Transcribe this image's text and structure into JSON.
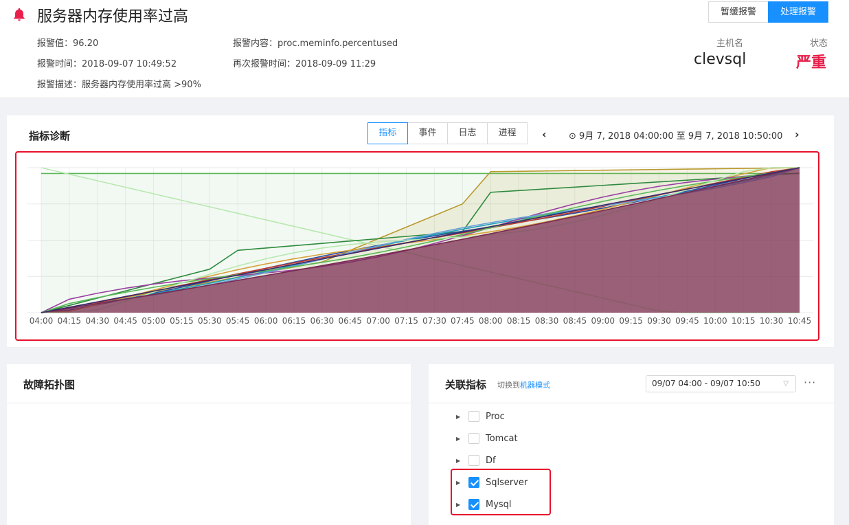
{
  "alert": {
    "title": "服务器内存使用率过高",
    "value_label": "报警值：",
    "value": "96.20",
    "time_label": "报警时间：",
    "time": "2018-09-07 10:49:52",
    "desc_label": "报警描述：",
    "desc": "服务器内存使用率过高 >90%",
    "content_label": "报警内容：",
    "content": "proc.meminfo.percentused",
    "retime_label": "再次报警时间：",
    "retime": "2018-09-09 11:29",
    "host_label": "主机名",
    "host": "clevsql",
    "status_label": "状态",
    "status": "严重",
    "snooze_button": "暂缓报警",
    "handle_button": "处理报警"
  },
  "diagnosis": {
    "title": "指标诊断",
    "tabs": [
      "指标",
      "事件",
      "日志",
      "进程"
    ],
    "active_tab": 0,
    "time_range": "9月 7, 2018 04:00:00 至 9月 7, 2018 10:50:00"
  },
  "topology": {
    "title": "故障拓扑图"
  },
  "related": {
    "title": "关联指标",
    "switch_prefix": "切换到",
    "switch_link": "机器模式",
    "date_range": "09/07 04:00 - 09/07 10:50",
    "items": [
      {
        "label": "Proc",
        "checked": false
      },
      {
        "label": "Tomcat",
        "checked": false
      },
      {
        "label": "Df",
        "checked": false
      },
      {
        "label": "Sqlserver",
        "checked": true
      },
      {
        "label": "Mysql",
        "checked": true
      }
    ]
  },
  "chart_data": {
    "type": "area",
    "x": [
      "04:00",
      "04:15",
      "04:30",
      "04:45",
      "05:00",
      "05:15",
      "05:30",
      "05:45",
      "06:00",
      "06:15",
      "06:30",
      "06:45",
      "07:00",
      "07:15",
      "07:30",
      "07:45",
      "08:00",
      "08:15",
      "08:30",
      "08:45",
      "09:00",
      "09:15",
      "09:30",
      "09:45",
      "10:00",
      "10:15",
      "10:30",
      "10:45"
    ],
    "grid": true,
    "colors": [
      "#b89a2e",
      "#2e8b3e",
      "#7a2a52",
      "#2b4ea0",
      "#d8a23a",
      "#1f9fbf",
      "#9a3fa0",
      "#c0392b",
      "#6aa0d8",
      "#5ab85a",
      "#b8e8b0"
    ]
  }
}
